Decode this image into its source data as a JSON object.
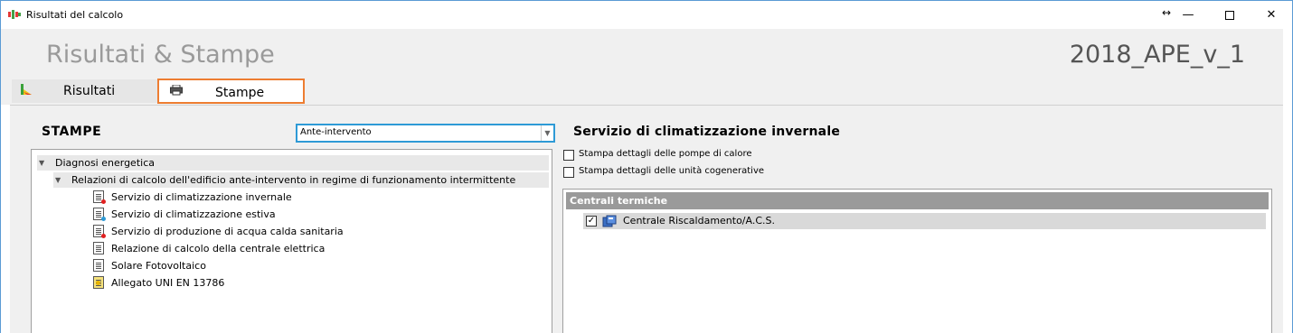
{
  "window": {
    "title": "Risultati del calcolo",
    "controls": {
      "resize": "↔",
      "minimize": "—",
      "maximize": "",
      "close": "✕"
    }
  },
  "header": {
    "title": "Risultati & Stampe",
    "project": "2018_APE_v_1"
  },
  "tabs": [
    {
      "label": "Risultati",
      "icon": "energy-class-icon",
      "active": false
    },
    {
      "label": "Stampe",
      "icon": "printer-icon",
      "active": true
    }
  ],
  "stampe": {
    "title": "STAMPE",
    "mode_select": {
      "value": "Ante-intervento"
    },
    "tree": {
      "root": {
        "label": "Diagnosi energetica",
        "expanded": true
      },
      "group": {
        "label": "Relazioni di calcolo dell'edificio ante-intervento in regime di funzionamento intermittente",
        "expanded": true
      },
      "items": [
        {
          "label": "Servizio di climatizzazione invernale",
          "icon": "report-heating-icon",
          "dot_color": "#e02020"
        },
        {
          "label": "Servizio di climatizzazione estiva",
          "icon": "report-cooling-icon",
          "dot_color": "#2e9ad6"
        },
        {
          "label": "Servizio di produzione di acqua calda sanitaria",
          "icon": "report-dhw-icon",
          "dot_color": "#e02020"
        },
        {
          "label": "Relazione di calcolo della centrale elettrica",
          "icon": "report-electric-icon",
          "dot_color": ""
        },
        {
          "label": "Solare Fotovoltaico",
          "icon": "report-pv-icon",
          "dot_color": ""
        },
        {
          "label": "Allegato UNI EN 13786",
          "icon": "report-attachment-icon",
          "dot_color": "#e8b400"
        }
      ]
    }
  },
  "service": {
    "title": "Servizio di climatizzazione invernale",
    "options": [
      {
        "label": "Stampa dettagli delle pompe di calore",
        "checked": false
      },
      {
        "label": "Stampa dettagli delle unità cogenerative",
        "checked": false
      }
    ],
    "plants": {
      "header": "Centrali termiche",
      "rows": [
        {
          "label": "Centrale Riscaldamento/A.C.S.",
          "checked": true,
          "icon": "boiler-plant-icon"
        }
      ]
    }
  },
  "colors": {
    "tab_highlight": "#ed7d31",
    "select_highlight": "#2e9ad6",
    "header_title": "#9a9a9a",
    "plants_header_bg": "#9a9a9a"
  }
}
